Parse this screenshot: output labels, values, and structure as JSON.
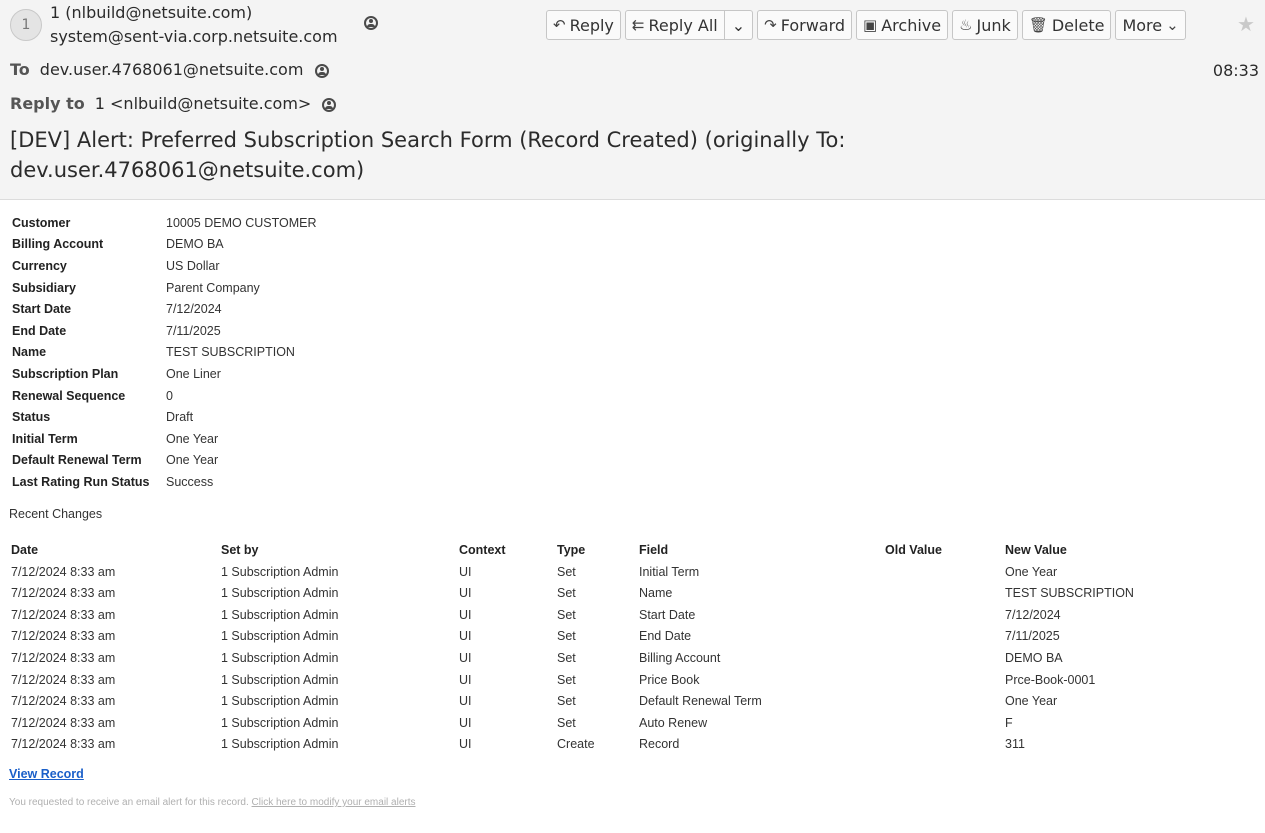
{
  "header": {
    "avatar_initial": "1",
    "from_name": "1 (nlbuild@netsuite.com)",
    "from_address": "system@sent-via.corp.netsuite.com",
    "to_label": "To",
    "to_value": "dev.user.4768061@netsuite.com",
    "time": "08:33",
    "reply_to_label": "Reply to",
    "reply_to_value": "1 <nlbuild@netsuite.com>",
    "subject": "[DEV] Alert: Preferred Subscription Search Form (Record Created) (originally To: dev.user.4768061@netsuite.com)"
  },
  "toolbar": {
    "reply": "Reply",
    "reply_all": "Reply All",
    "forward": "Forward",
    "archive": "Archive",
    "junk": "Junk",
    "delete": "Delete",
    "more": "More"
  },
  "fields": [
    {
      "label": "Customer",
      "value": "10005 DEMO CUSTOMER"
    },
    {
      "label": "Billing Account",
      "value": "DEMO BA"
    },
    {
      "label": "Currency",
      "value": "US Dollar"
    },
    {
      "label": "Subsidiary",
      "value": "Parent Company"
    },
    {
      "label": "Start Date",
      "value": "7/12/2024"
    },
    {
      "label": "End Date",
      "value": "7/11/2025"
    },
    {
      "label": "Name",
      "value": "TEST SUBSCRIPTION"
    },
    {
      "label": "Subscription Plan",
      "value": "One Liner"
    },
    {
      "label": "Renewal Sequence",
      "value": "0"
    },
    {
      "label": "Status",
      "value": "Draft"
    },
    {
      "label": "Initial Term",
      "value": "One Year"
    },
    {
      "label": "Default Renewal Term",
      "value": "One Year"
    },
    {
      "label": "Last Rating Run Status",
      "value": "Success"
    }
  ],
  "recent_changes": {
    "title": "Recent Changes",
    "columns": [
      "Date",
      "Set by",
      "Context",
      "Type",
      "Field",
      "Old Value",
      "New Value"
    ],
    "rows": [
      [
        "7/12/2024 8:33 am",
        "1 Subscription Admin",
        "UI",
        "Set",
        "Initial Term",
        "",
        "One Year"
      ],
      [
        "7/12/2024 8:33 am",
        "1 Subscription Admin",
        "UI",
        "Set",
        "Name",
        "",
        "TEST SUBSCRIPTION"
      ],
      [
        "7/12/2024 8:33 am",
        "1 Subscription Admin",
        "UI",
        "Set",
        "Start Date",
        "",
        "7/12/2024"
      ],
      [
        "7/12/2024 8:33 am",
        "1 Subscription Admin",
        "UI",
        "Set",
        "End Date",
        "",
        "7/11/2025"
      ],
      [
        "7/12/2024 8:33 am",
        "1 Subscription Admin",
        "UI",
        "Set",
        "Billing Account",
        "",
        "DEMO BA"
      ],
      [
        "7/12/2024 8:33 am",
        "1 Subscription Admin",
        "UI",
        "Set",
        "Price Book",
        "",
        "Prce-Book-0001"
      ],
      [
        "7/12/2024 8:33 am",
        "1 Subscription Admin",
        "UI",
        "Set",
        "Default Renewal Term",
        "",
        "One Year"
      ],
      [
        "7/12/2024 8:33 am",
        "1 Subscription Admin",
        "UI",
        "Set",
        "Auto Renew",
        "",
        "F"
      ],
      [
        "7/12/2024 8:33 am",
        "1 Subscription Admin",
        "UI",
        "Create",
        "Record",
        "",
        "311"
      ]
    ]
  },
  "view_record_link": "View Record",
  "footer": {
    "text": "You requested to receive an email alert for this record.",
    "link": "Click here to modify your email alerts"
  }
}
